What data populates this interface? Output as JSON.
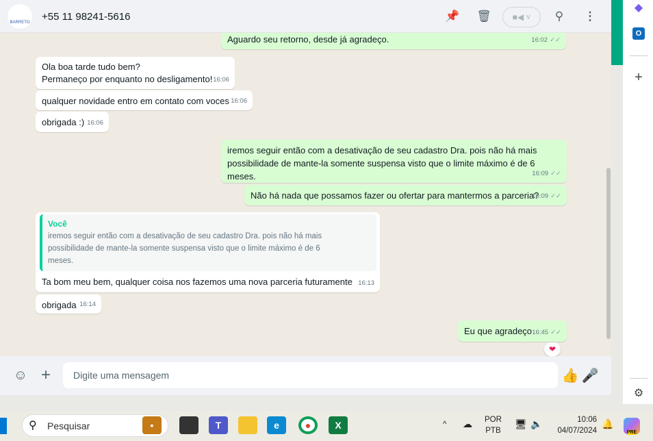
{
  "header": {
    "contact": "+55 11 98241-5616",
    "avatar_text": "BARRETO"
  },
  "messages": [
    {
      "dir": "out",
      "text": "Aguardo seu retorno, desde já agradeço.",
      "time": "16:02"
    },
    {
      "dir": "in",
      "lines": [
        "Ola boa tarde tudo bem?",
        "Permaneço por enquanto no desligamento!"
      ],
      "time": "16:06"
    },
    {
      "dir": "in",
      "text": "qualquer novidade entro em contato com voces",
      "time": "16:06"
    },
    {
      "dir": "in",
      "text": "obrigada :)",
      "time": "16:06"
    },
    {
      "dir": "out",
      "lines": [
        "iremos seguir então com a desativação de seu cadastro Dra. pois não há mais",
        "possibilidade de mante-la somente suspensa visto que o limite máximo é de 6 meses."
      ],
      "time": "16:09"
    },
    {
      "dir": "out",
      "text": "Não há nada que possamos fazer ou ofertar para mantermos a parceria?",
      "time": "16:09"
    },
    {
      "dir": "in",
      "quote_author": "Você",
      "quote_lines": [
        "iremos seguir então com a desativação de seu cadastro Dra. pois não há mais",
        "possibilidade de mante-la somente suspensa visto que o limite máximo é de 6",
        "meses."
      ],
      "text": "Ta bom meu bem, qualquer coisa nos fazemos uma nova parceria futuramente",
      "time": "16:13"
    },
    {
      "dir": "in",
      "text": "obrigada",
      "time": "16:14"
    },
    {
      "dir": "out",
      "text": "Eu que agradeço",
      "time": "16:45",
      "reaction": "❤"
    }
  ],
  "composer": {
    "placeholder": "Digite uma mensagem"
  },
  "taskbar": {
    "search": "Pesquisar",
    "lang1": "POR",
    "lang2": "PTB",
    "time": "10:06",
    "date": "04/07/2024",
    "copilot_badge": "PRE"
  }
}
